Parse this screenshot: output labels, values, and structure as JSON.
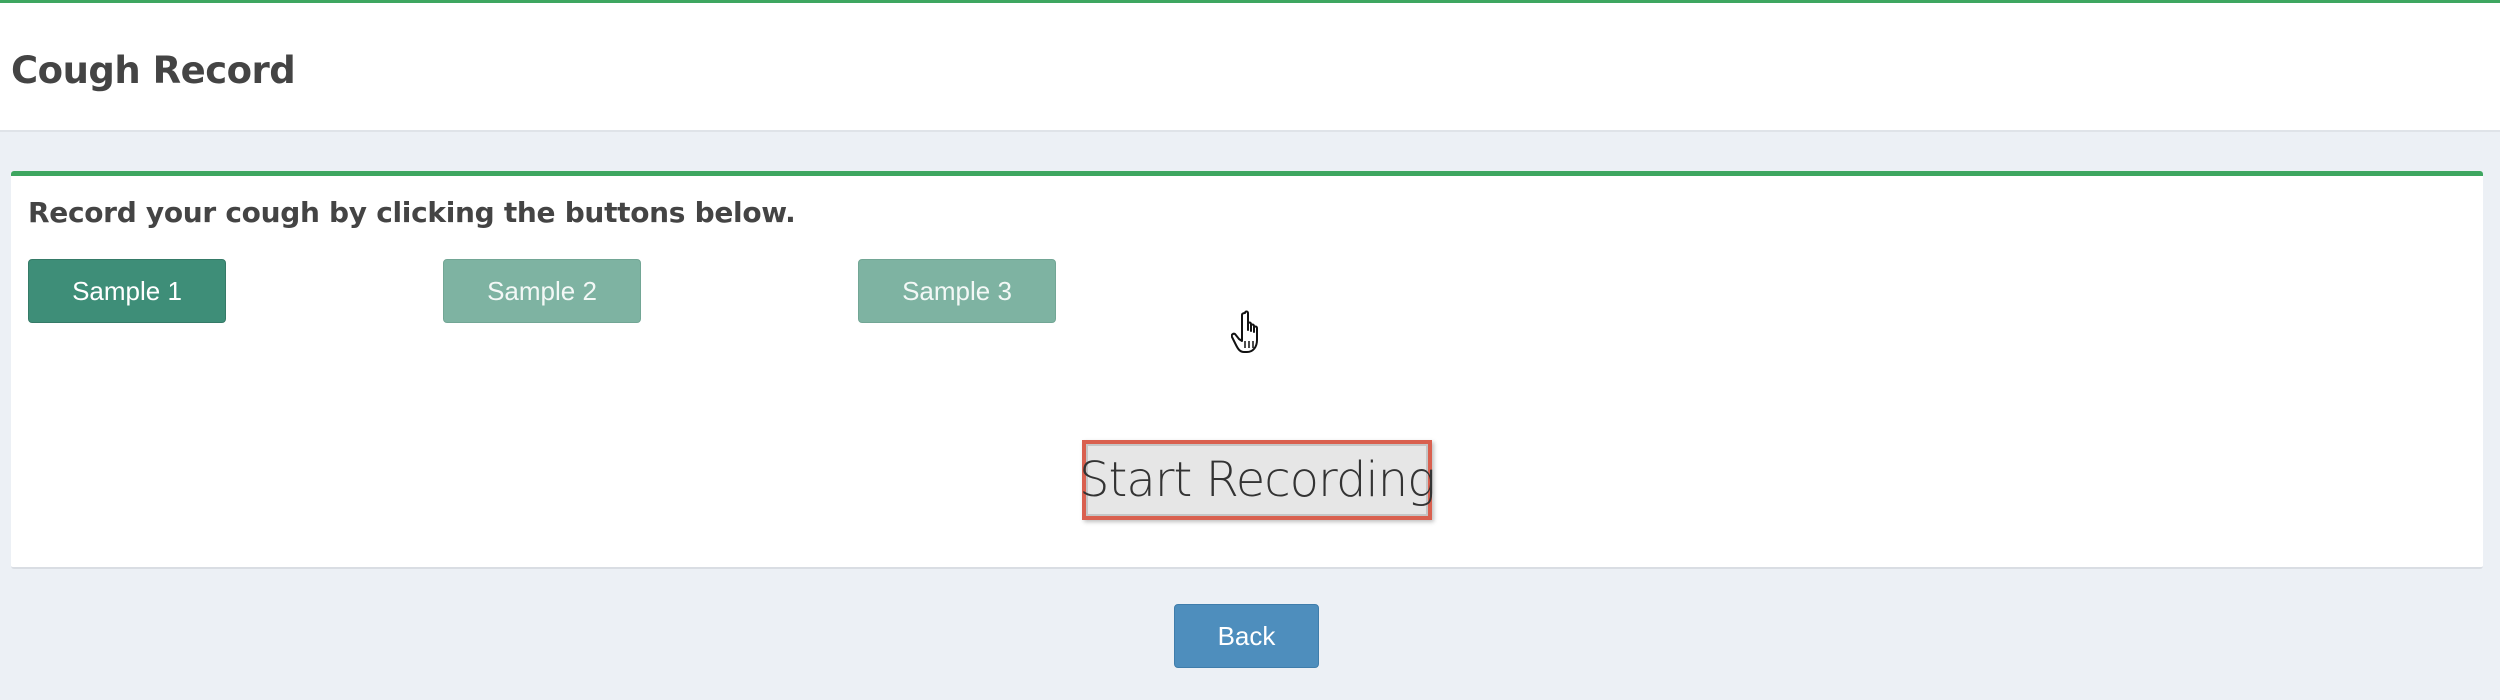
{
  "header": {
    "title": "Cough Record"
  },
  "main": {
    "instruction": "Record your cough by clicking the buttons below.",
    "samples": [
      {
        "label": "Sample 1",
        "state": "active"
      },
      {
        "label": "Sample 2",
        "state": "disabled"
      },
      {
        "label": "Sample 3",
        "state": "disabled"
      }
    ],
    "record_button": "Start Recording"
  },
  "footer": {
    "back_label": "Back"
  },
  "colors": {
    "accent_green": "#3ea660",
    "sample_active": "#3e8e78",
    "sample_disabled": "#7eb3a2",
    "record_border": "#d9604f",
    "back_button": "#4e8ebd",
    "page_background": "#ecf0f5"
  },
  "icons": {
    "cursor": "hand-pointer-icon"
  }
}
